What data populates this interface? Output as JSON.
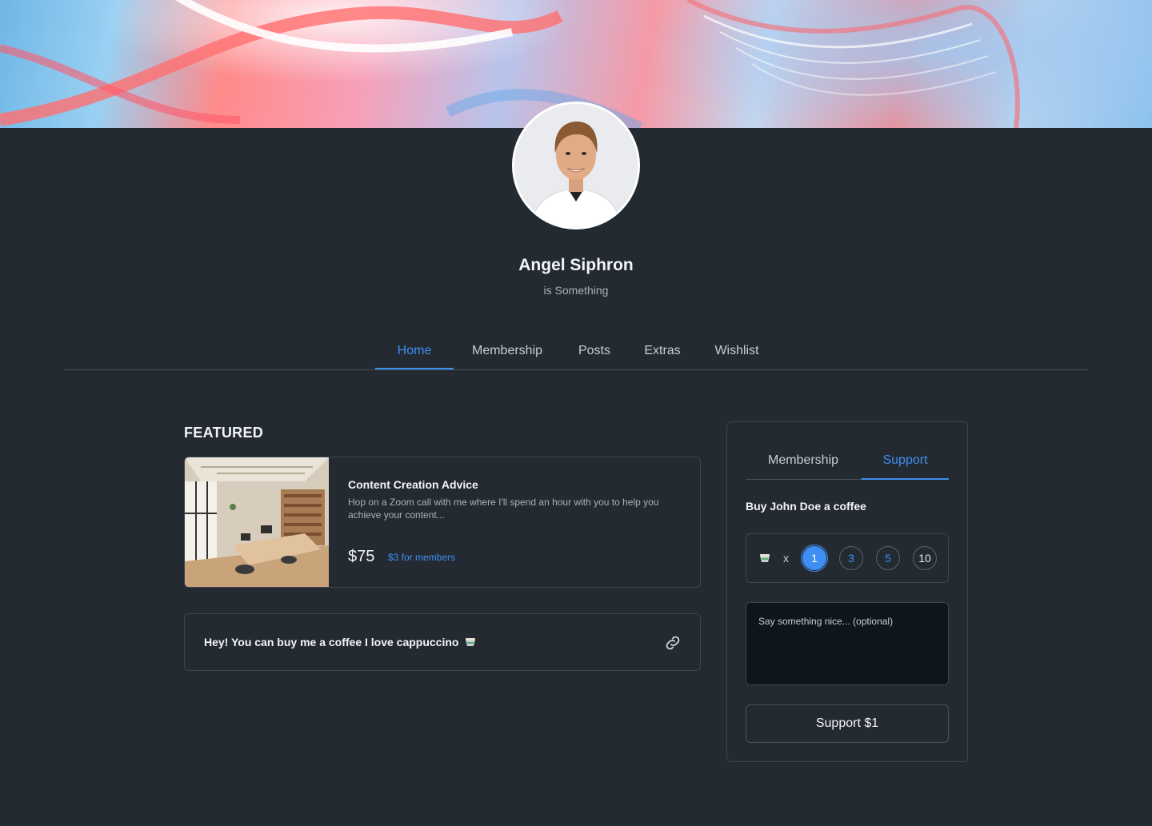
{
  "profile": {
    "name": "Angel Siphron",
    "subtitle": "is Something"
  },
  "nav": {
    "tabs": [
      {
        "label": "Home",
        "active": true
      },
      {
        "label": "Membership",
        "active": false
      },
      {
        "label": "Posts",
        "active": false
      },
      {
        "label": "Extras",
        "active": false
      },
      {
        "label": "Wishlist",
        "active": false
      }
    ]
  },
  "featured": {
    "heading": "FEATURED",
    "card": {
      "title": "Content Creation Advice",
      "description": "Hop on a Zoom call with me where I'll spend an hour with you to help you achieve your content...",
      "price": "$75",
      "member_price": "$3 for members"
    },
    "coffee_note": {
      "text": "Hey! You can buy me a coffee I love cappuccino",
      "icon": "link-icon"
    }
  },
  "support_panel": {
    "tabs": [
      {
        "label": "Membership",
        "active": false
      },
      {
        "label": "Support",
        "active": true
      }
    ],
    "heading": "Buy John Doe a coffee",
    "multiplier": "x",
    "quantities": [
      "1",
      "3",
      "5",
      "10"
    ],
    "selected_quantity": "1",
    "message_placeholder": "Say something nice... (optional)",
    "button_label": "Support $1"
  },
  "colors": {
    "background": "#242a31",
    "accent": "#3f8ef2",
    "border": "#3e454e"
  }
}
